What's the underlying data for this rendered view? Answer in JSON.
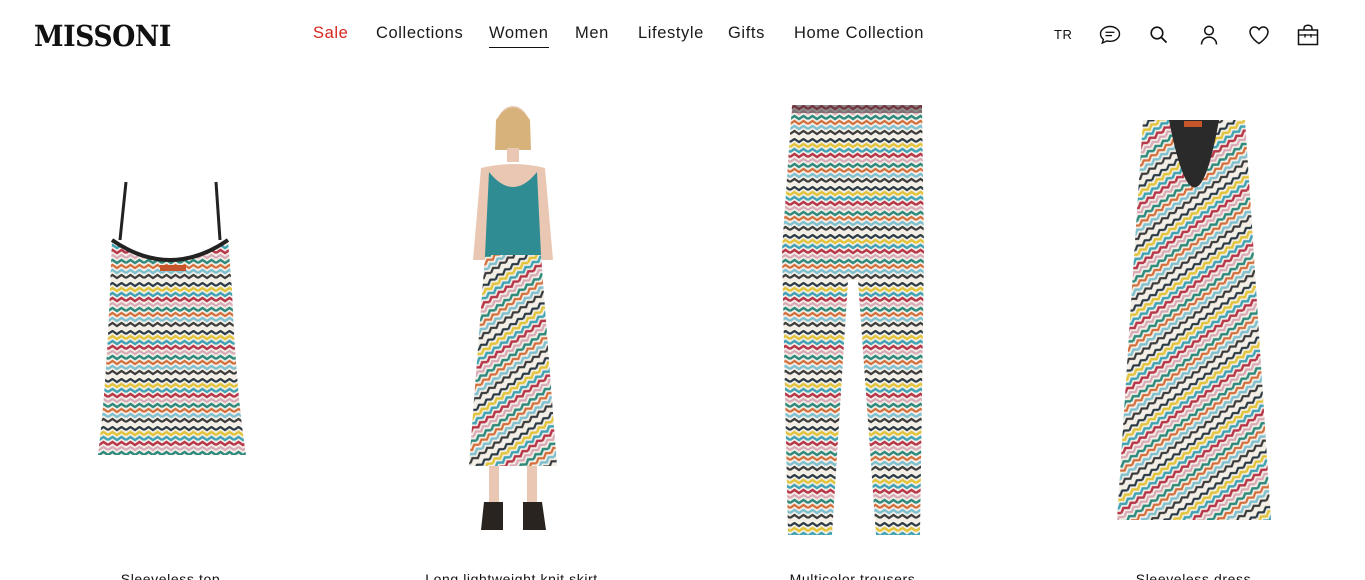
{
  "brand": {
    "logo": "MISSONI"
  },
  "nav": {
    "items": [
      {
        "label": "Sale"
      },
      {
        "label": "Collections"
      },
      {
        "label": "Women"
      },
      {
        "label": "Men"
      },
      {
        "label": "Lifestyle"
      },
      {
        "label": "Gifts"
      },
      {
        "label": "Home Collection"
      }
    ],
    "active": "Women"
  },
  "utilities": {
    "language": "TR",
    "icons": [
      "chat-icon",
      "search-icon",
      "account-icon",
      "wishlist-icon",
      "bag-icon"
    ]
  },
  "colors": {
    "sale": "#d5261f",
    "text": "#111111",
    "background": "#ffffff"
  },
  "products": [
    {
      "title": "Sleeveless top",
      "image": "zigzag sleeveless top"
    },
    {
      "title": "Long lightweight knit skirt",
      "image": "model in teal tank and zigzag skirt"
    },
    {
      "title": "Multicolor trousers",
      "image": "zigzag trousers"
    },
    {
      "title": "Sleeveless dress",
      "image": "zigzag sleeveless dress"
    }
  ]
}
